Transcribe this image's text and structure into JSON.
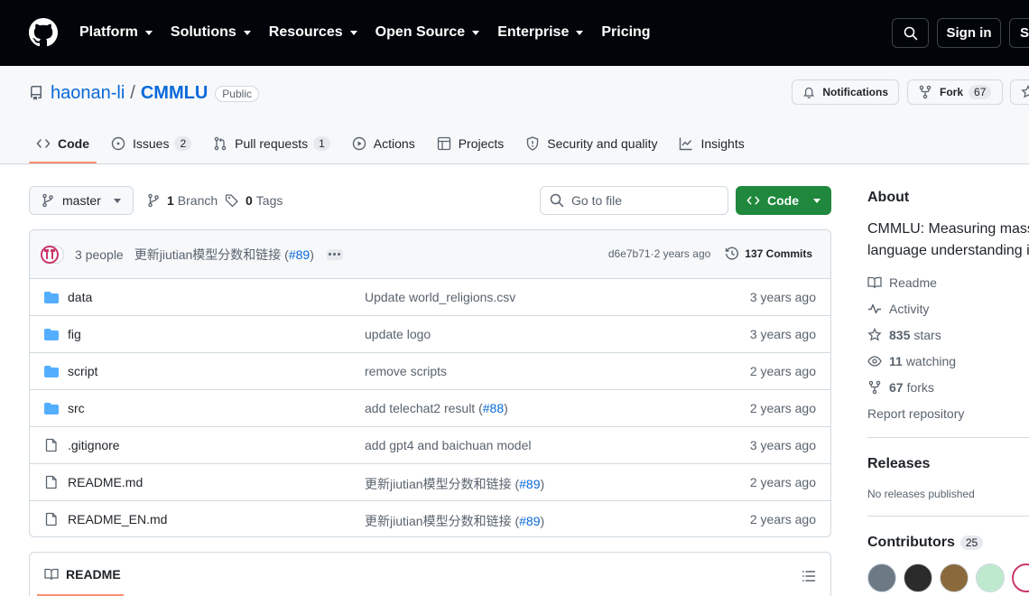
{
  "topnav": {
    "menu": [
      {
        "label": "Platform",
        "dropdown": true
      },
      {
        "label": "Solutions",
        "dropdown": true
      },
      {
        "label": "Resources",
        "dropdown": true
      },
      {
        "label": "Open Source",
        "dropdown": true
      },
      {
        "label": "Enterprise",
        "dropdown": true
      },
      {
        "label": "Pricing",
        "dropdown": false
      }
    ],
    "sign_in": "Sign in",
    "sign_up_partial": "Si"
  },
  "repo": {
    "owner": "haonan-li",
    "separator": "/",
    "name": "CMMLU",
    "visibility": "Public",
    "notifications_label": "Notifications",
    "fork_label": "Fork",
    "fork_count": "67"
  },
  "tabs": [
    {
      "label": "Code",
      "count": "",
      "icon": "code-icon",
      "selected": true
    },
    {
      "label": "Issues",
      "count": "2",
      "icon": "issue-icon",
      "selected": false
    },
    {
      "label": "Pull requests",
      "count": "1",
      "icon": "pull-request-icon",
      "selected": false
    },
    {
      "label": "Actions",
      "count": "",
      "icon": "play-icon",
      "selected": false
    },
    {
      "label": "Projects",
      "count": "",
      "icon": "table-icon",
      "selected": false
    },
    {
      "label": "Security and quality",
      "count": "",
      "icon": "shield-icon",
      "selected": false
    },
    {
      "label": "Insights",
      "count": "",
      "icon": "graph-icon",
      "selected": false
    }
  ],
  "toolbar": {
    "branch": "master",
    "branch_count": "1",
    "branch_word": "Branch",
    "tag_count": "0",
    "tag_word": "Tags",
    "goto_placeholder": "Go to file",
    "code_button": "Code"
  },
  "commit": {
    "people": "3 people",
    "message_prefix": "更新jiutian模型分数和链接 (",
    "message_ref": "#89",
    "message_suffix": ")",
    "sha": "d6e7b71",
    "separator": " · ",
    "age": "2 years ago",
    "commit_count": "137 Commits"
  },
  "files": [
    {
      "type": "dir",
      "name": "data",
      "message": "Update world_religions.csv",
      "ref": "",
      "age": "3 years ago"
    },
    {
      "type": "dir",
      "name": "fig",
      "message": "update logo",
      "ref": "",
      "age": "3 years ago"
    },
    {
      "type": "dir",
      "name": "script",
      "message": "remove scripts",
      "ref": "",
      "age": "2 years ago"
    },
    {
      "type": "dir",
      "name": "src",
      "message": "add telechat2 result (",
      "ref": "#88",
      "age": "2 years ago"
    },
    {
      "type": "file",
      "name": ".gitignore",
      "message": "add gpt4 and baichuan model",
      "ref": "",
      "age": "3 years ago"
    },
    {
      "type": "file",
      "name": "README.md",
      "message": "更新jiutian模型分数和链接 (",
      "ref": "#89",
      "age": "2 years ago"
    },
    {
      "type": "file",
      "name": "README_EN.md",
      "message": "更新jiutian模型分数和链接 (",
      "ref": "#89",
      "age": "2 years ago"
    }
  ],
  "readme": {
    "tab_label": "README"
  },
  "sidebar": {
    "about_heading": "About",
    "about_line1": "CMMLU: Measuring mass",
    "about_line2": "language understanding i",
    "readme": "Readme",
    "activity": "Activity",
    "stars_count": "835",
    "stars_word": "stars",
    "watching_count": "11",
    "watching_word": "watching",
    "forks_count": "67",
    "forks_word": "forks",
    "report": "Report repository",
    "releases_heading": "Releases",
    "releases_empty": "No releases published",
    "contributors_heading": "Contributors",
    "contributors_count": "25"
  },
  "colors": {
    "nav_bg": "#010409",
    "accent_blue": "#0969da",
    "primary_green": "#1f883d",
    "folder_blue": "#54aeff",
    "tab_underline": "#fd8c73"
  }
}
